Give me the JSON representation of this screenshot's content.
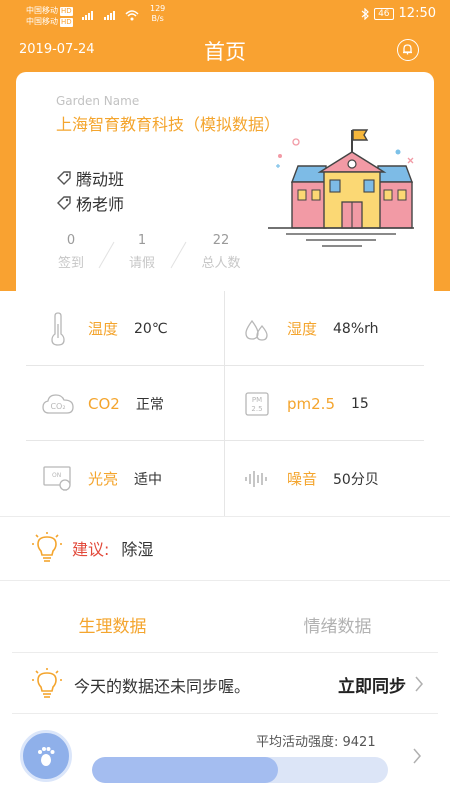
{
  "status_bar": {
    "carrier1": "中国移动",
    "carrier2": "中国移动",
    "hd": "HD",
    "speed_value": "129",
    "speed_unit": "B/s",
    "battery": "46",
    "time": "12:50"
  },
  "header": {
    "date": "2019-07-24",
    "title": "首页"
  },
  "school_card": {
    "garden_label": "Garden Name",
    "school_name": "上海智育教育科技（模拟数据）",
    "class_name": "腾动班",
    "teacher": "杨老师",
    "stats": [
      {
        "value": "0",
        "label": "签到"
      },
      {
        "value": "1",
        "label": "请假"
      },
      {
        "value": "22",
        "label": "总人数"
      }
    ]
  },
  "environment": {
    "temperature": {
      "label": "温度",
      "value": "20℃",
      "icon": "thermometer-icon"
    },
    "humidity": {
      "label": "湿度",
      "value": "48%rh",
      "icon": "water-drops-icon"
    },
    "co2": {
      "label": "CO2",
      "value": "正常",
      "icon": "co2-cloud-icon",
      "icon_text": "CO₂"
    },
    "pm25": {
      "label": "pm2.5",
      "value": "15",
      "icon": "pm25-icon",
      "icon_text_top": "PM",
      "icon_text_bottom": "2.5"
    },
    "light": {
      "label": "光亮",
      "value": "适中",
      "icon": "light-sensor-icon"
    },
    "noise": {
      "label": "噪音",
      "value": "50分贝",
      "icon": "sound-wave-icon"
    }
  },
  "advice": {
    "key": "建议:",
    "value": "除湿"
  },
  "tabs": [
    {
      "label": "生理数据",
      "active": true
    },
    {
      "label": "情绪数据",
      "active": false
    }
  ],
  "sync": {
    "message": "今天的数据还未同步喔。",
    "button": "立即同步"
  },
  "activity": {
    "label": "平均活动强度: 9421",
    "progress_fraction": 0.63
  },
  "colors": {
    "brand": "#f9a231",
    "accent_text": "#f4a52e",
    "advice_red": "#e24a3b",
    "progress": "#a4bdf0"
  }
}
